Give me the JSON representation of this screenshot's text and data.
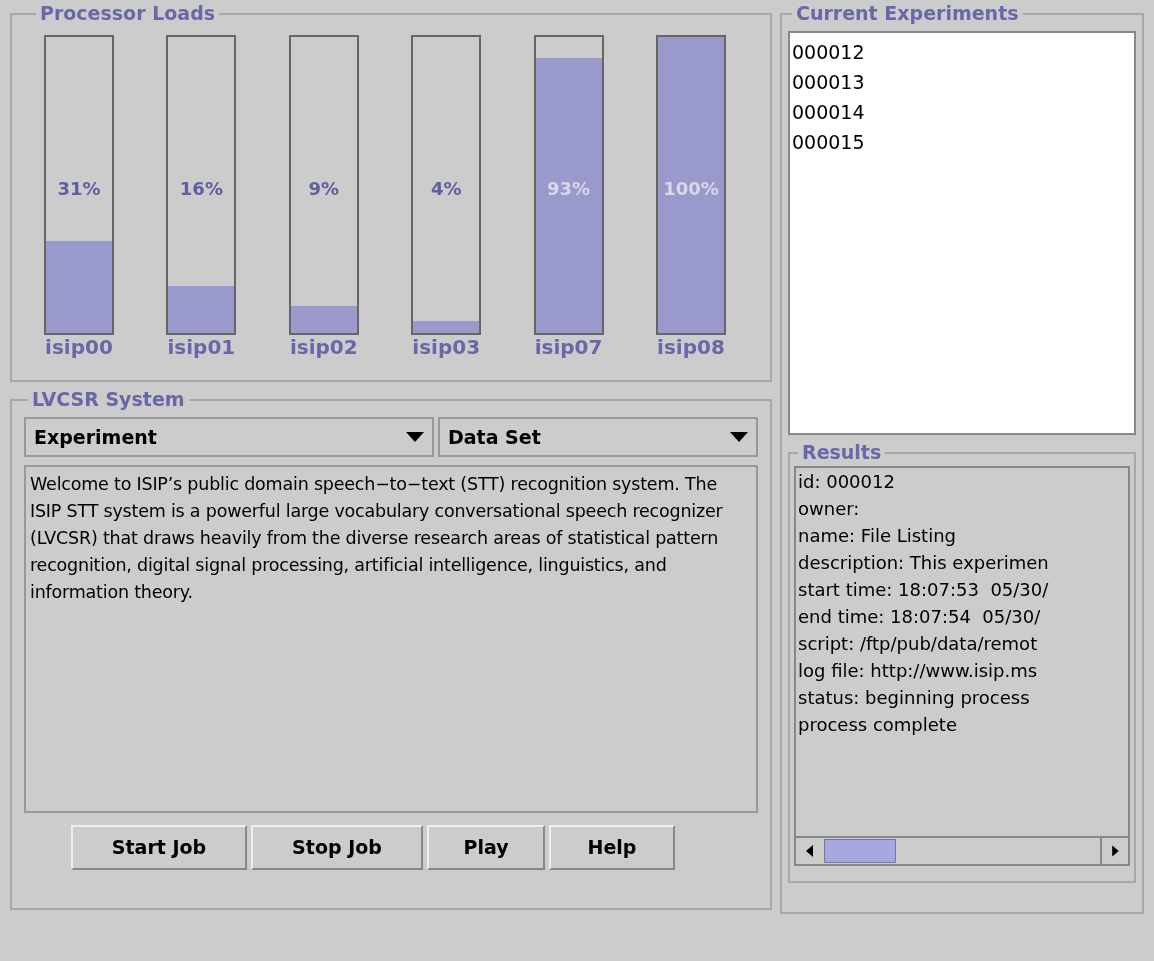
{
  "processor_loads": {
    "title": "Processor Loads",
    "processors": [
      {
        "name": "isip00",
        "reading": "31%",
        "level": 0.31
      },
      {
        "name": "isip01",
        "reading": "16%",
        "level": 0.16
      },
      {
        "name": "isip02",
        "reading": "9%",
        "level": 0.09
      },
      {
        "name": "isip03",
        "reading": "4%",
        "level": 0.04
      },
      {
        "name": "isip07",
        "reading": "93%",
        "level": 0.93
      },
      {
        "name": "isip08",
        "reading": "100%",
        "level": 1.0
      }
    ]
  },
  "lvcsr_system": {
    "title": "LVCSR System",
    "dropdowns": [
      "Experiment",
      "Data Set"
    ],
    "description": "Welcome to ISIP’s public domain speech−to−text (STT) recognition system. The ISIP STT system is a powerful large vocabulary conversational speech recognizer (LVCSR) that draws heavily from the diverse research areas of statistical pattern recognition, digital signal processing, artificial intelligence, linguistics, and information theory.",
    "buttons": [
      "Start Job",
      "Stop Job",
      "Play",
      "Help"
    ]
  },
  "current_experiments": {
    "title": "Current Experiments",
    "items": [
      "000012",
      "000013",
      "000014",
      "000015"
    ]
  },
  "results": {
    "title": "Results",
    "lines": [
      "id: 000012",
      "owner:",
      "name: File Listing",
      "description: This experimen",
      "start time: 18:07:53  05/30/",
      "end time: 18:07:54  05/30/",
      "script: /ftp/pub/data/remot",
      "log file: http://www.isip.ms",
      "status: beginning process",
      "process complete"
    ]
  }
}
